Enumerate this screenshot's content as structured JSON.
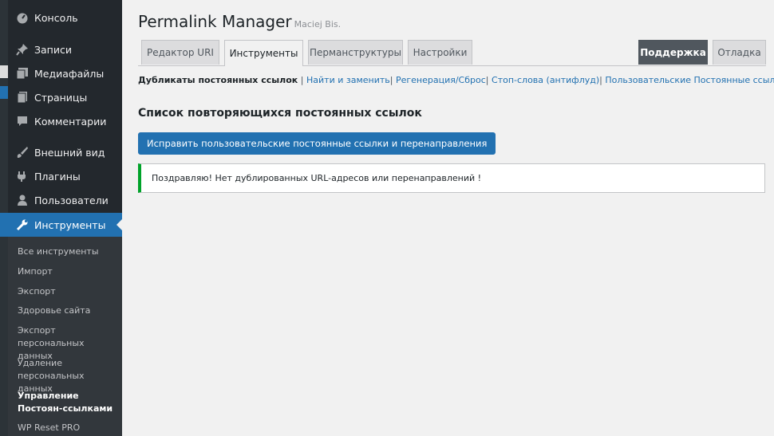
{
  "sidebar": {
    "items": [
      {
        "label": "Консоль",
        "icon": "dashboard-icon"
      },
      {
        "label": "Записи",
        "icon": "pin-icon"
      },
      {
        "label": "Медиафайлы",
        "icon": "media-icon"
      },
      {
        "label": "Страницы",
        "icon": "pages-icon"
      },
      {
        "label": "Комментарии",
        "icon": "comments-icon"
      },
      {
        "label": "Внешний вид",
        "icon": "appearance-icon"
      },
      {
        "label": "Плагины",
        "icon": "plugins-icon"
      },
      {
        "label": "Пользователи",
        "icon": "users-icon"
      },
      {
        "label": "Инструменты",
        "icon": "tools-icon"
      }
    ],
    "submenu": [
      "Все инструменты",
      "Импорт",
      "Экспорт",
      "Здоровье сайта",
      "Экспорт персональных данных",
      "Удаление персональных данных",
      "Управление Постоян-ссылками",
      "WP Reset PRO"
    ]
  },
  "header": {
    "title": "Permalink Manager",
    "author": "Maciej Bis."
  },
  "tabs": [
    {
      "label": "Редактор URI"
    },
    {
      "label": "Инструменты"
    },
    {
      "label": "Перманструктуры"
    },
    {
      "label": "Настройки"
    }
  ],
  "right_tabs": [
    {
      "label": "Поддержка"
    },
    {
      "label": "Отладка"
    }
  ],
  "subnav": {
    "current": "Дубликаты постоянных ссылок",
    "links": [
      "Найти и заменить",
      "Регенерация/Сброс",
      "Стоп-слова (антифлуд)",
      "Пользовательские Постоянные ссылки"
    ],
    "separator": "|"
  },
  "section": {
    "title": "Список повторяющихся постоянных ссылок",
    "button": "Исправить пользовательские постоянные ссылки и перенаправления",
    "notice": "Поздравляю! Нет дублированных URL-адресов или перенаправлений !"
  },
  "colors": {
    "accent": "#2271b1",
    "sidebar": "#23282d",
    "success": "#00a32a"
  }
}
